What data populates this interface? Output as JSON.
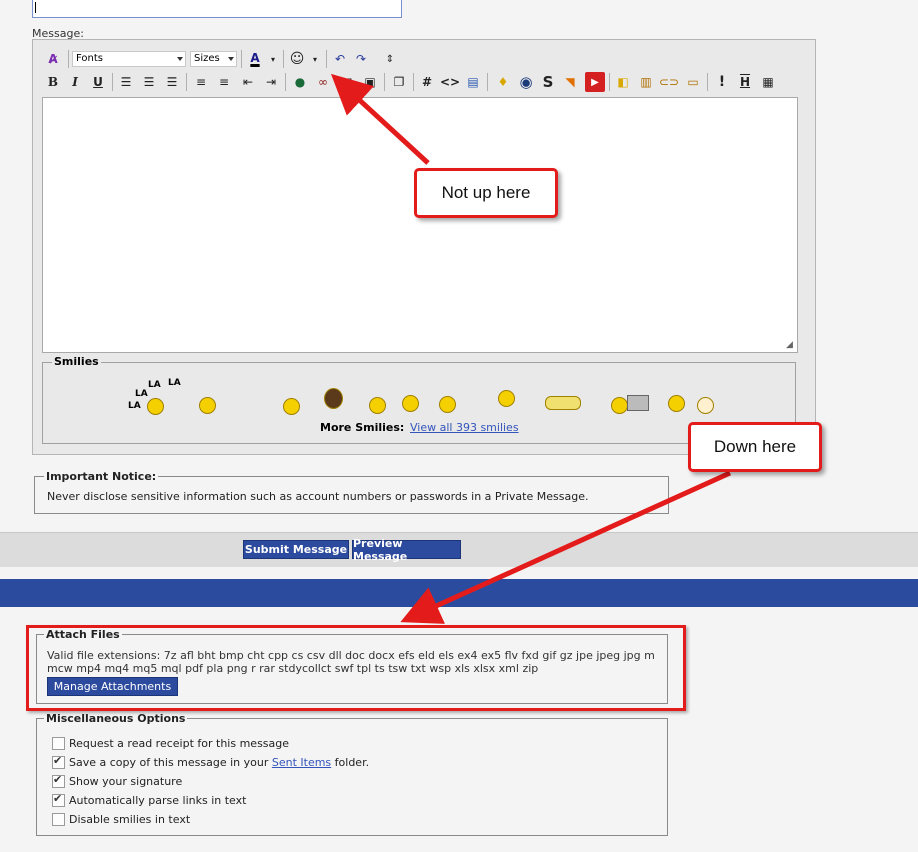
{
  "message_label": "Message:",
  "toolbar": {
    "fonts_label": "Fonts",
    "sizes_label": "Sizes",
    "bold": "B",
    "italic": "I",
    "underline": "U",
    "code_hash": "#",
    "code_tags": "<>"
  },
  "smilies": {
    "legend": "Smilies",
    "la_text": "LA",
    "more_label": "More Smilies:",
    "view_all": "View all 393 smilies"
  },
  "notice": {
    "legend": "Important Notice:",
    "text": "Never disclose sensitive information such as account numbers or passwords in a Private Message."
  },
  "buttons": {
    "submit": "Submit Message",
    "preview": "Preview Message",
    "manage_attachments": "Manage Attachments"
  },
  "attach": {
    "legend": "Attach Files",
    "text": "Valid file extensions: 7z afl bht bmp cht cpp cs csv dll doc docx efs eld els ex4 ex5 flv fxd gif gz jpe jpeg jpg m mcw mp4 mq4 mq5 mql pdf pla png r rar stdycollct swf tpl ts tsw txt wsp xls xlsx xml zip"
  },
  "misc": {
    "legend": "Miscellaneous Options",
    "options": [
      {
        "label": "Request a read receipt for this message",
        "checked": false
      },
      {
        "label_before": "Save a copy of this message in your ",
        "link": "Sent Items",
        "label_after": " folder.",
        "checked": true
      },
      {
        "label": "Show your signature",
        "checked": true
      },
      {
        "label": "Automatically parse links in text",
        "checked": true
      },
      {
        "label": "Disable smilies in text",
        "checked": false
      }
    ]
  },
  "callouts": {
    "top": "Not up here",
    "bottom": "Down here"
  },
  "colors": {
    "accent_blue": "#2b4c9e",
    "callout_red": "#e41b1b",
    "link_blue": "#3355bb"
  }
}
